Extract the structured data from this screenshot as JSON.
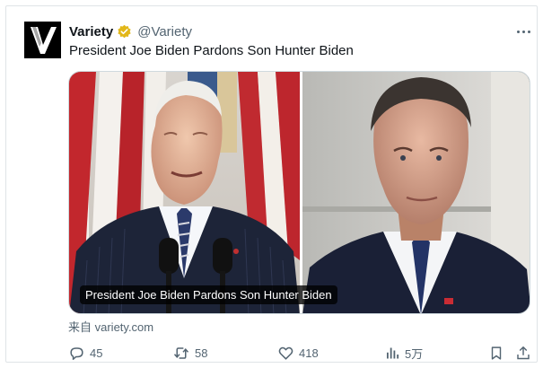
{
  "tweet": {
    "author": {
      "display_name": "Variety",
      "handle": "@Variety",
      "verified": true,
      "avatar_icon": "variety-v-logo",
      "avatar_letter": "V"
    },
    "text": "President Joe Biden Pardons Son Hunter Biden",
    "more_icon": "more-options-icon"
  },
  "card": {
    "caption": "President Joe Biden Pardons Son Hunter Biden",
    "source_prefix": "来自 ",
    "source_domain": "variety.com"
  },
  "actions": {
    "reply_count": "45",
    "retweet_count": "58",
    "like_count": "418",
    "views_count": "5万"
  },
  "colors": {
    "text_primary": "#0f1419",
    "text_secondary": "#536471",
    "verified_gold": "#e2b719",
    "border": "#cfd9de"
  }
}
